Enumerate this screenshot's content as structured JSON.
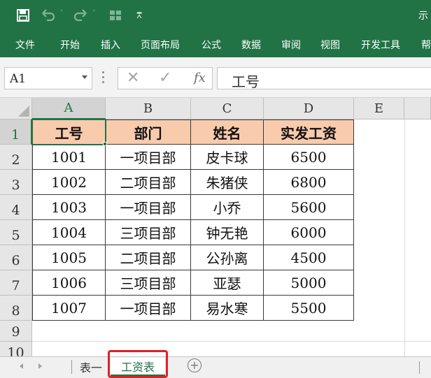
{
  "titlebar": {
    "title_partial": "示",
    "icons": [
      "save-icon",
      "undo-icon",
      "redo-icon",
      "form-icon",
      "customize-qat-icon"
    ]
  },
  "ribbon": {
    "tabs": [
      "文件",
      "开始",
      "插入",
      "页面布局",
      "公式",
      "数据",
      "审阅",
      "视图",
      "开发工具",
      "帮"
    ]
  },
  "formula": {
    "name_box": "A1",
    "cancel_symbol": "✕",
    "enter_symbol": "✓",
    "fx_label": "fx",
    "content": "工号"
  },
  "sheet": {
    "columns": [
      "A",
      "B",
      "C",
      "D",
      "E"
    ],
    "rows": [
      "1",
      "2",
      "3",
      "4",
      "5",
      "6",
      "7",
      "8",
      "9",
      "10"
    ],
    "header": [
      "工号",
      "部门",
      "姓名",
      "实发工资"
    ],
    "data": [
      [
        "1001",
        "一项目部",
        "皮卡球",
        "6500"
      ],
      [
        "1002",
        "二项目部",
        "朱猪侠",
        "6800"
      ],
      [
        "1003",
        "一项目部",
        "小乔",
        "5600"
      ],
      [
        "1004",
        "三项目部",
        "钟无艳",
        "6000"
      ],
      [
        "1005",
        "二项目部",
        "公孙离",
        "4500"
      ],
      [
        "1006",
        "三项目部",
        "亚瑟",
        "5000"
      ],
      [
        "1007",
        "一项目部",
        "易水寒",
        "5500"
      ]
    ],
    "active_cell": "A1"
  },
  "sheet_tabs": {
    "tabs": [
      "表一",
      "工资表"
    ],
    "active": "工资表",
    "add_symbol": "+"
  },
  "colors": {
    "excel_green": "#217346",
    "header_fill": "#f8cbad",
    "highlight_red": "#e02020"
  }
}
